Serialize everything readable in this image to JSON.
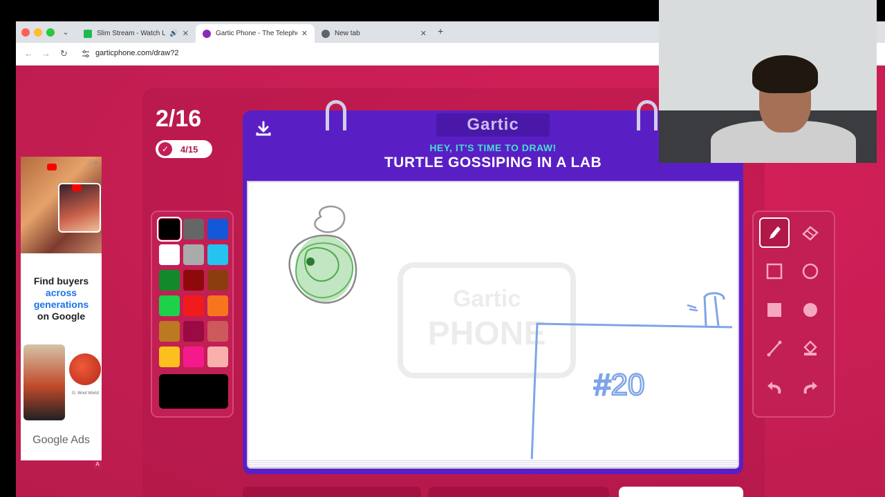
{
  "browser": {
    "tabs": [
      {
        "title": "Slim Stream - Watch Live",
        "favicon_color": "#1db954",
        "muted_icon": "speaker-icon"
      },
      {
        "title": "Gartic Phone - The Telephone",
        "favicon_color": "#8b2bb5",
        "active": true
      },
      {
        "title": "New tab",
        "favicon_color": "#5f6368"
      }
    ],
    "url": "garticphone.com/draw?2"
  },
  "game": {
    "round": "2/16",
    "done_count": "4/15",
    "logo": "Gartic",
    "prompt_heading": "HEY, IT'S TIME TO DRAW!",
    "prompt": "TURTLE GOSSIPING IN A LAB",
    "watermark": "Gartic PHONE",
    "drawing_text": "#20"
  },
  "palette": {
    "colors": [
      "#000000",
      "#666666",
      "#1457d9",
      "#ffffff",
      "#aaaaaa",
      "#24c3f0",
      "#138a2a",
      "#8e0a0a",
      "#8c3d0f",
      "#1ed14a",
      "#f21b1b",
      "#f7751c",
      "#bb7a22",
      "#9a0a44",
      "#cc5a5a",
      "#fcc01e",
      "#f51a8c",
      "#f9b0ad"
    ],
    "current": "#000000"
  },
  "tools": [
    "pencil-icon",
    "eraser-icon",
    "rectangle-outline-icon",
    "circle-outline-icon",
    "rectangle-fill-icon",
    "circle-fill-icon",
    "line-icon",
    "bucket-icon",
    "undo-icon",
    "redo-icon"
  ],
  "ad": {
    "headline_top": "Find buyers",
    "headline_blue_1": "across",
    "headline_blue_2": "generations",
    "headline_bottom": "on Google",
    "brand_label": "G. Wool World",
    "footer": "Google Ads",
    "badge": "A"
  }
}
